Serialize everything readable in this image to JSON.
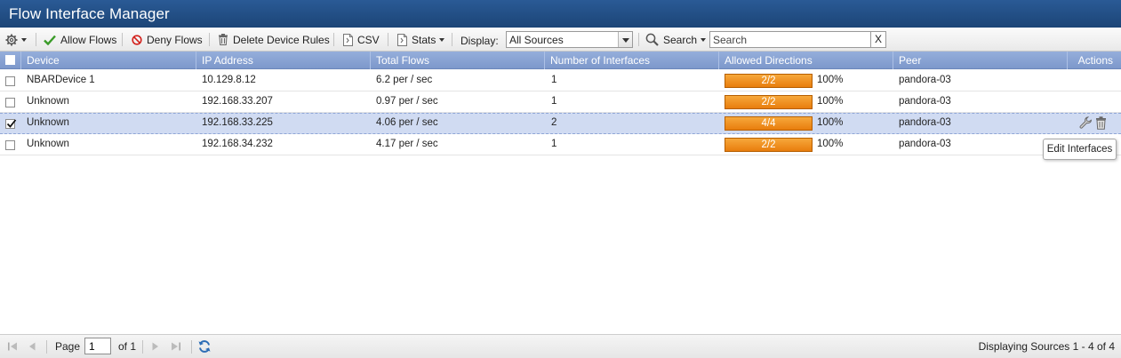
{
  "window": {
    "title": "Flow Interface Manager"
  },
  "toolbar": {
    "settings_icon": "gear-icon",
    "allow_label": "Allow Flows",
    "deny_label": "Deny Flows",
    "delete_label": "Delete Device Rules",
    "csv_label": "CSV",
    "stats_label": "Stats",
    "display_label": "Display:",
    "display_value": "All Sources",
    "search_label": "Search",
    "search_placeholder": "Search",
    "clear_label": "X"
  },
  "columns": [
    "Device",
    "IP Address",
    "Total Flows",
    "Number of Interfaces",
    "Allowed Directions",
    "Peer",
    "Actions"
  ],
  "rows": [
    {
      "device": "NBARDevice 1",
      "ip": "10.129.8.12",
      "flows": "6.2 per / sec",
      "interfaces": "1",
      "directions": "2/2",
      "percent": "100%",
      "directions_fill": 1.0,
      "peer": "pandora-03",
      "selected": false
    },
    {
      "device": "Unknown",
      "ip": "192.168.33.207",
      "flows": "0.97 per / sec",
      "interfaces": "1",
      "directions": "2/2",
      "percent": "100%",
      "directions_fill": 1.0,
      "peer": "pandora-03",
      "selected": false
    },
    {
      "device": "Unknown",
      "ip": "192.168.33.225",
      "flows": "4.06 per / sec",
      "interfaces": "2",
      "directions": "4/4",
      "percent": "100%",
      "directions_fill": 1.0,
      "peer": "pandora-03",
      "selected": true
    },
    {
      "device": "Unknown",
      "ip": "192.168.34.232",
      "flows": "4.17 per / sec",
      "interfaces": "1",
      "directions": "2/2",
      "percent": "100%",
      "directions_fill": 1.0,
      "peer": "pandora-03",
      "selected": false
    }
  ],
  "row_actions": {
    "edit_icon": "wrench-icon",
    "delete_icon": "trash-icon"
  },
  "tooltip": "Edit Interfaces",
  "pager": {
    "page_label": "Page",
    "page_value": "1",
    "of_label": "of 1",
    "status": "Displaying Sources 1 - 4 of 4"
  },
  "colors": {
    "title_bar": "#1f4a7e",
    "header": "#8aa4d3",
    "bar": "#f0921f",
    "selected_row": "#d0dbf2"
  }
}
